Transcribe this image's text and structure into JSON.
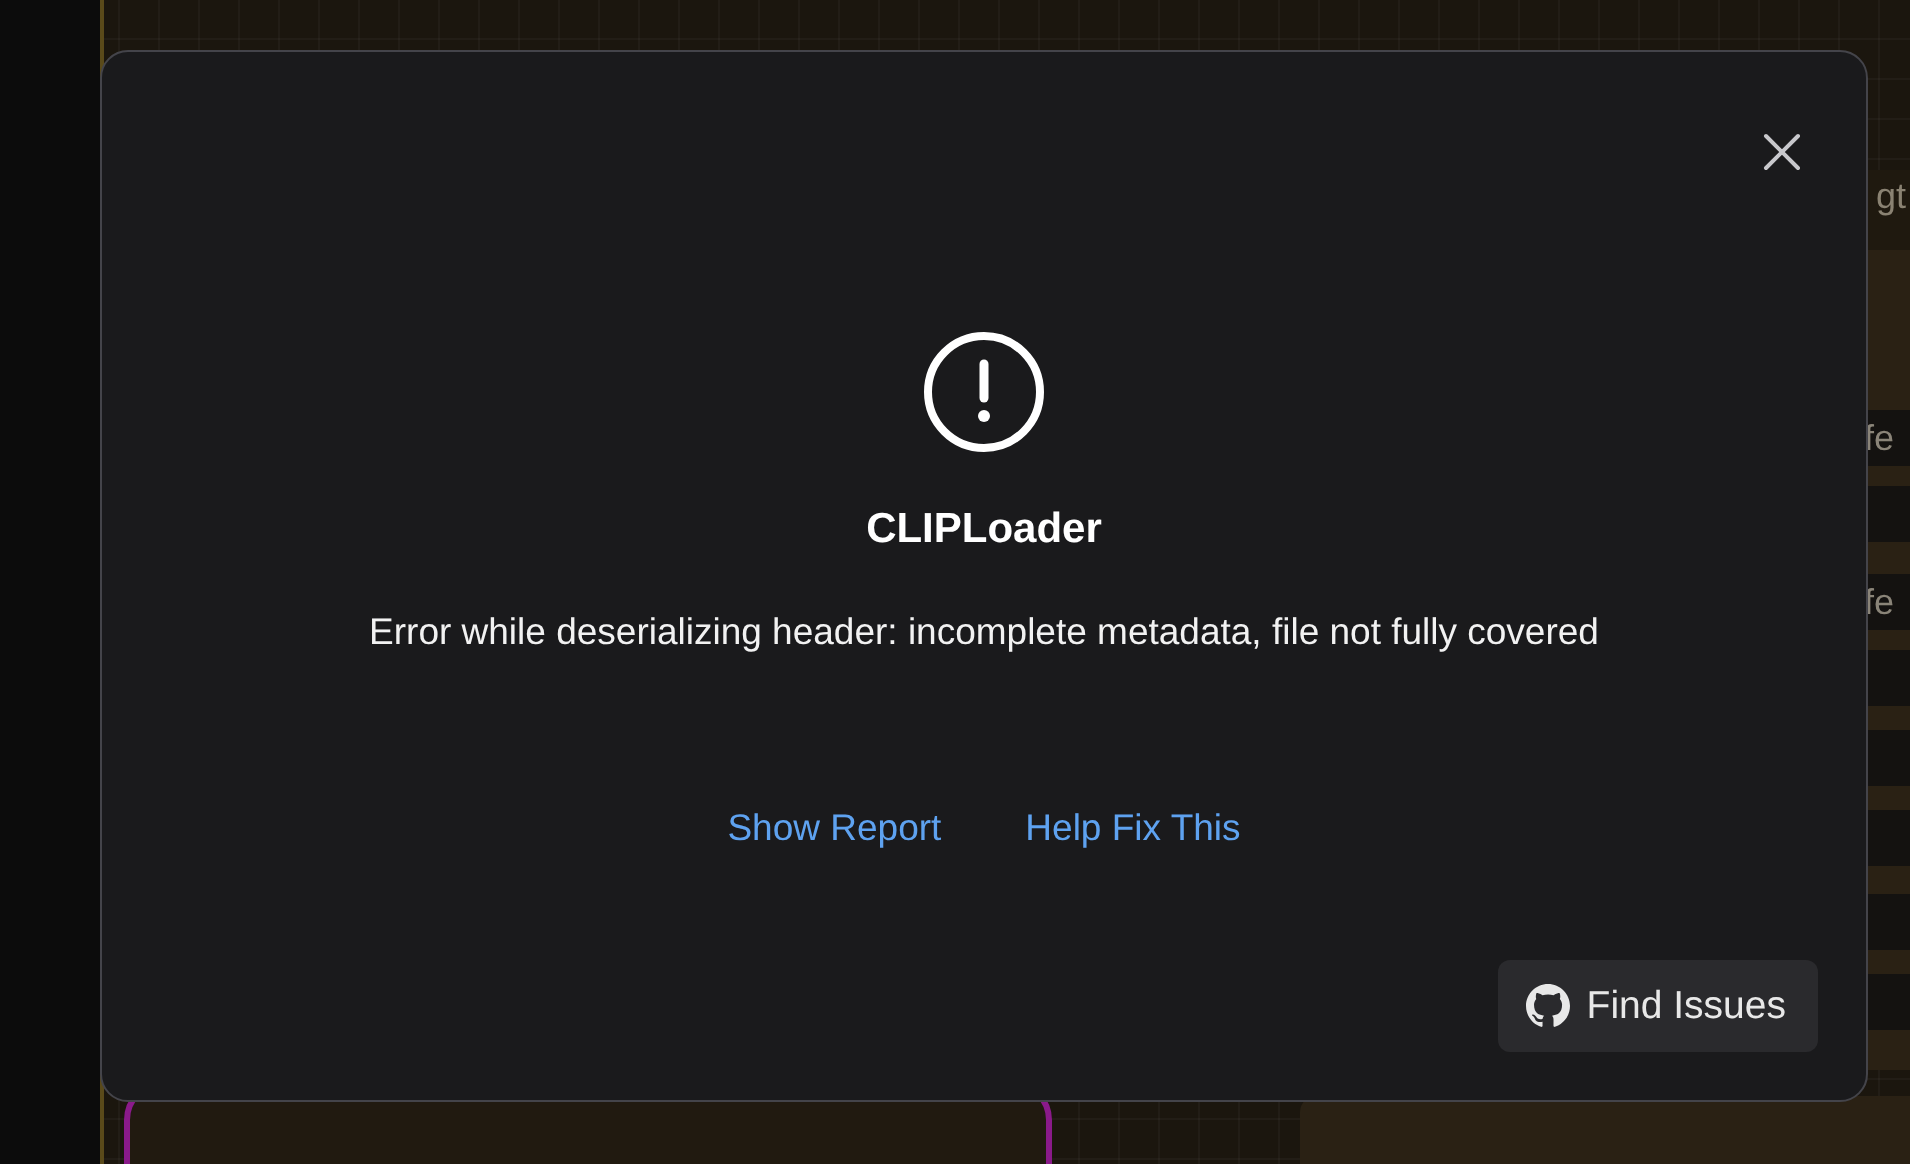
{
  "background": {
    "node_texts": [
      "gt",
      "fe",
      "fe"
    ]
  },
  "dialog": {
    "title": "CLIPLoader",
    "message": "Error while deserializing header: incomplete metadata, file not fully covered",
    "links": [
      "Show Report",
      "Help Fix This"
    ],
    "button": {
      "label": "Find Issues"
    }
  }
}
